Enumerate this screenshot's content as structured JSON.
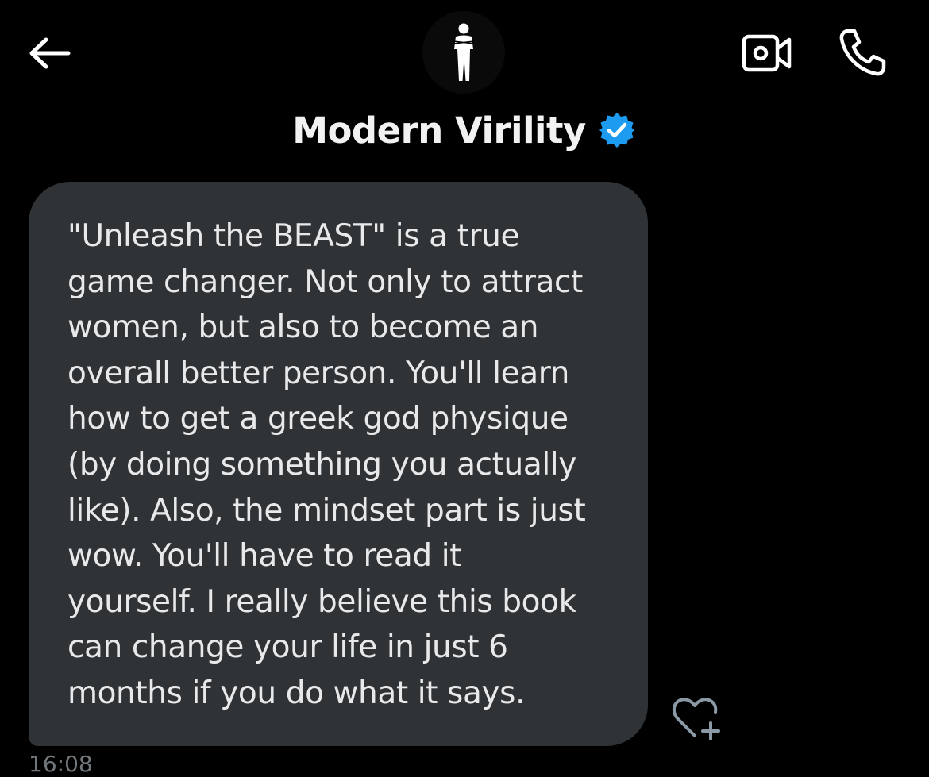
{
  "header": {
    "back_icon": "arrow-left-icon",
    "avatar_icon": "standing-man-arms-crossed-icon",
    "contact_name": "Modern Virility",
    "verified_icon": "verified-badge-icon",
    "video_icon": "video-camera-icon",
    "call_icon": "phone-icon"
  },
  "message": {
    "lines": [
      "\"Unleash the BEAST\" is a true",
      "game changer. Not only to attract",
      "women, but also to become an",
      "overall better person. You'll learn",
      "how to get a greek god physique",
      "(by doing something you actually",
      "like). Also, the mindset part is just",
      "wow. You'll have to read it",
      "yourself. I really believe this book",
      "can change your life in just 6",
      "months if you do what it says."
    ],
    "react_icon": "heart-plus-icon",
    "timestamp": "16:08"
  },
  "colors": {
    "background": "#000000",
    "bubble": "#2f3336",
    "text": "#e7e9ea",
    "verified_blue": "#1d9bf0",
    "muted": "#71767b"
  }
}
